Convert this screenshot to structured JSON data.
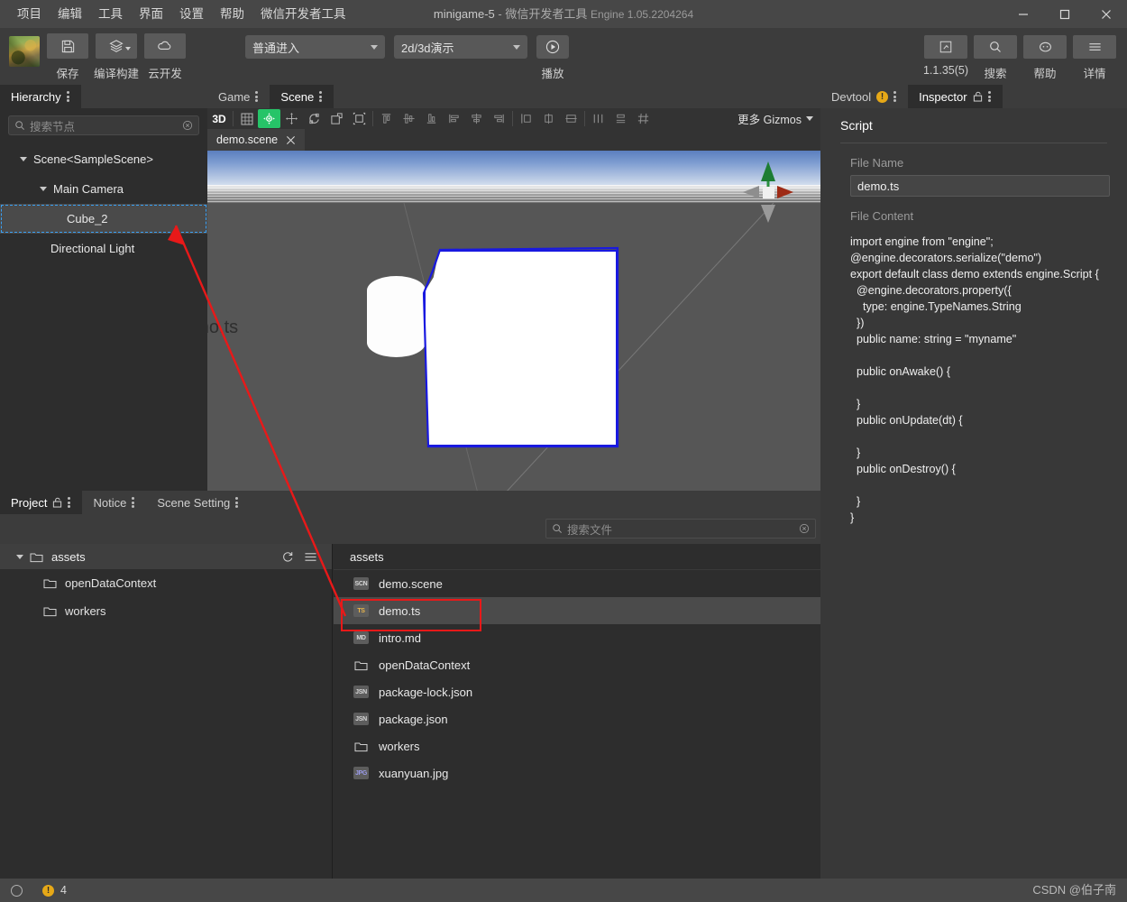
{
  "titlebar": {
    "menus": [
      "项目",
      "编辑",
      "工具",
      "界面",
      "设置",
      "帮助",
      "微信开发者工具"
    ],
    "project_name": "minigame-5",
    "dash": "-",
    "app_name": "微信开发者工具",
    "engine": "Engine 1.05.2204264",
    "window_controls": [
      "minimize-button",
      "maximize-button",
      "close-button"
    ]
  },
  "toolbar": {
    "buttons": [
      {
        "label": "保存",
        "icon": "save-icon"
      },
      {
        "label": "编译构建",
        "icon": "layers-icon"
      },
      {
        "label": "云开发",
        "icon": "cloud-icon"
      }
    ],
    "mode_select": "普通进入",
    "demo_select": "2d/3d演示",
    "play_label": "播放",
    "right_buttons": [
      {
        "label": "1.1.35(5)",
        "icon": "version-icon"
      },
      {
        "label": "搜索",
        "icon": "search-icon"
      },
      {
        "label": "帮助",
        "icon": "help-chat-icon"
      },
      {
        "label": "详情",
        "icon": "hamburger-icon"
      }
    ]
  },
  "hierarchy": {
    "tab_label": "Hierarchy",
    "search_placeholder": "搜索节点",
    "nodes": [
      {
        "label": "Scene<SampleScene>",
        "indent": 22,
        "caret": true,
        "selected": false,
        "drop": false
      },
      {
        "label": "Main Camera",
        "indent": 44,
        "caret": true,
        "selected": false,
        "drop": false
      },
      {
        "label": "Cube_2",
        "indent": 74,
        "caret": false,
        "selected": true,
        "drop": true
      },
      {
        "label": "Directional Light",
        "indent": 56,
        "caret": false,
        "selected": false,
        "drop": false
      }
    ]
  },
  "scene_view": {
    "tabs": [
      {
        "label": "Game",
        "active": false
      },
      {
        "label": "Scene",
        "active": true
      }
    ],
    "mode_label": "3D",
    "tool_icons": [
      "grid-icon",
      "move-gizmo-icon",
      "pan-icon",
      "rotate-icon",
      "scale-icon",
      "rect-transform-icon",
      "align-top-icon",
      "align-vcenter-icon",
      "align-bottom-icon",
      "align-left-icon",
      "align-hcenter-icon",
      "align-right-icon",
      "distribute-left-icon",
      "distribute-center-icon",
      "distribute-vertical-icon",
      "distribute-horizontal-icon",
      "grid-snap-icon"
    ],
    "active_tool_index": 1,
    "gizmos_label": "更多 Gizmos",
    "file_tab": "demo.scene",
    "drag_ghost_text": "demo.ts"
  },
  "inspector": {
    "tabs": [
      {
        "label": "Devtool",
        "active": false,
        "badge": "!"
      },
      {
        "label": "Inspector",
        "active": true,
        "lock": true
      }
    ],
    "section_title": "Script",
    "file_name_label": "File Name",
    "file_name_value": "demo.ts",
    "file_content_label": "File Content",
    "file_content": "import engine from \"engine\";\n@engine.decorators.serialize(\"demo\")\nexport default class demo extends engine.Script {\n  @engine.decorators.property({\n    type: engine.TypeNames.String\n  })\n  public name: string = \"myname\"\n\n  public onAwake() {\n\n  }\n  public onUpdate(dt) {\n\n  }\n  public onDestroy() {\n\n  }\n}"
  },
  "project": {
    "tabs": [
      {
        "label": "Project",
        "active": true,
        "lock": true
      },
      {
        "label": "Notice",
        "active": false,
        "lock": false
      },
      {
        "label": "Scene Setting",
        "active": false,
        "lock": false
      }
    ],
    "search_placeholder": "搜索文件",
    "tree_root": "assets",
    "tree_children": [
      "openDataContext",
      "workers"
    ],
    "breadcrumb": "assets",
    "files": [
      {
        "name": "demo.scene",
        "type": "SCN",
        "kind": "file",
        "selected": false
      },
      {
        "name": "demo.ts",
        "type": "TS",
        "kind": "file",
        "selected": true
      },
      {
        "name": "intro.md",
        "type": "MD",
        "kind": "file",
        "selected": false
      },
      {
        "name": "openDataContext",
        "type": "",
        "kind": "folder",
        "selected": false
      },
      {
        "name": "package-lock.json",
        "type": "JSN",
        "kind": "file",
        "selected": false
      },
      {
        "name": "package.json",
        "type": "JSN",
        "kind": "file",
        "selected": false
      },
      {
        "name": "workers",
        "type": "",
        "kind": "folder",
        "selected": false
      },
      {
        "name": "xuanyuan.jpg",
        "type": "JPG",
        "kind": "file",
        "selected": false
      }
    ]
  },
  "statusbar": {
    "warning_count": "4",
    "watermark": "CSDN @伯子南"
  },
  "colors": {
    "accent_green": "#26c468",
    "annotation_red": "#e81919",
    "warning_orange": "#e6a817",
    "drop_blue": "#3aa0f3",
    "selection_outline": "#1919e0"
  }
}
